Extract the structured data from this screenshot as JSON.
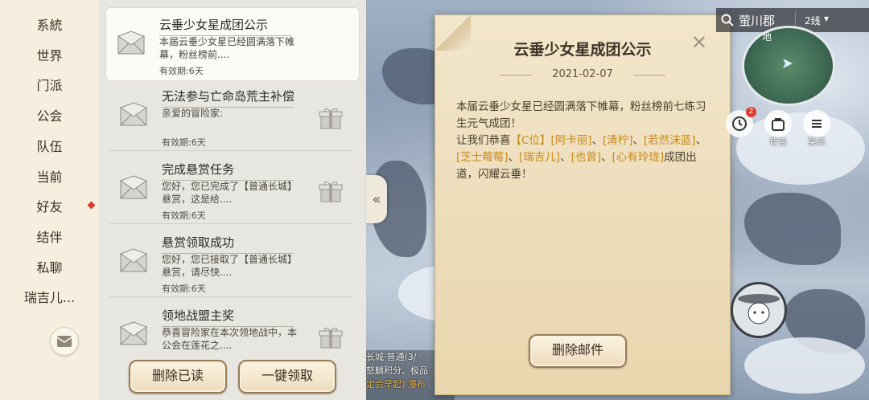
{
  "nav": {
    "items": [
      "系統",
      "世界",
      "门派",
      "公会",
      "队伍",
      "当前",
      "好友",
      "结伴",
      "私聊",
      "瑞吉儿..."
    ],
    "badge_item_index": 6
  },
  "mails": [
    {
      "title": "云垂少女星成团公示",
      "preview": "本届云垂少女星已经圆满落下帷幕，粉丝榜前....",
      "expiry": "有效期:6天",
      "has_gift": false,
      "selected": true
    },
    {
      "title": "无法参与亡命岛荒主补偿",
      "preview": "亲爱的冒险家:",
      "expiry": "有效期:6天",
      "has_gift": true,
      "selected": false
    },
    {
      "title": "完成悬赏任务",
      "preview": "您好，您已完成了【普通长城】悬赏，这是给....",
      "expiry": "有效期:6天",
      "has_gift": true,
      "selected": false
    },
    {
      "title": "悬赏领取成功",
      "preview": "您好，您已接取了【普通长城】悬赏，请尽快....",
      "expiry": "有效期:6天",
      "has_gift": false,
      "selected": false
    },
    {
      "title": "领地战盟主奖",
      "preview": "恭喜冒险家在本次领地战中，本公会在莲花之....",
      "expiry": "",
      "has_gift": true,
      "selected": false
    }
  ],
  "buttons": {
    "delete_read": "删除已读",
    "claim_all": "一键领取",
    "delete_mail": "删除邮件"
  },
  "collapse_icon": "«",
  "letter": {
    "title": "云垂少女星成团公示",
    "date": "2021-02-07",
    "close_glyph": "✕",
    "body_line1": "本届云垂少女星已经圆满落下帷幕，粉丝榜前七练习生元气成团！",
    "body_line2_prefix": "让我们恭喜",
    "names": [
      "【C位】",
      "[阿卡丽]",
      "[清柠]",
      "[若然沫蓝]",
      "[芝士莓莓]",
      "[瑞吉儿]",
      "[也曾]",
      "[心有玲珑]"
    ],
    "body_line2_suffix": "成团出道，闪耀云垂！"
  },
  "hud": {
    "location": "萤川郡",
    "line": "2线",
    "map_label": "地",
    "bag_label": "背包",
    "menu_label": "菜单",
    "clock_badge": "2"
  },
  "chat": {
    "line1": "长城·普通(3/",
    "line2": "怒麟积分、极品",
    "line3": "定会早起] 瀑布"
  },
  "colors": {
    "highlight": "#c98a18",
    "badge_red": "#e03a2e",
    "button_border": "#9a7b55",
    "letter_bg": "#f2e6cb"
  }
}
